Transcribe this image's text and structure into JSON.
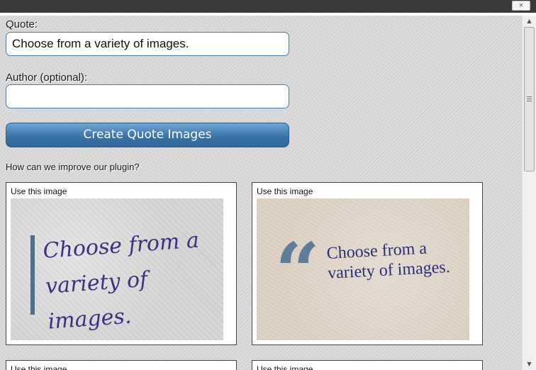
{
  "window": {
    "close_label": "×"
  },
  "form": {
    "quote_label": "Quote:",
    "quote_value": "Choose from a variety of images.",
    "author_label": "Author (optional):",
    "author_value": "",
    "create_button": "Create Quote Images",
    "improve_link": "How can we improve our plugin?"
  },
  "cards": [
    {
      "label": "Use this image",
      "quote_text": "Choose from a variety of images.",
      "style": "script",
      "text_color": "#3a3280",
      "accent_color": "#4f6f8f"
    },
    {
      "label": "Use this image",
      "quote_text": "Choose from a variety of images.",
      "style": "serif",
      "text_color": "#2a2f7a",
      "accent_color": "#5d7d99",
      "quote_mark": "“"
    },
    {
      "label": "Use this image"
    },
    {
      "label": "Use this image"
    }
  ],
  "scrollbar": {
    "up_arrow": "▲",
    "down_arrow": "▼",
    "position": 0.0
  },
  "colors": {
    "topbar": "#3a3a3a",
    "button": "#3a73a8",
    "input_border": "#4a7fa5",
    "background": "#d8d8d8"
  }
}
